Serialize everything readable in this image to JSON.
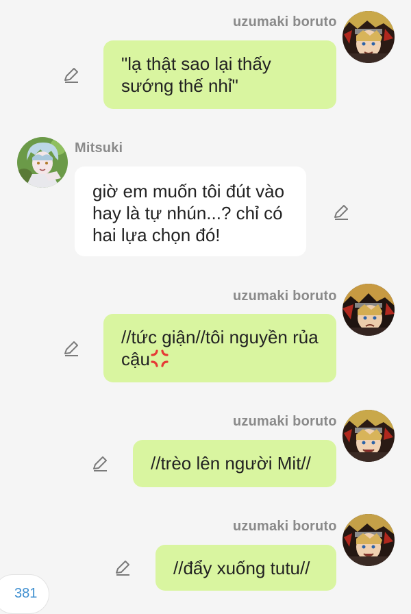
{
  "messages": [
    {
      "sender": "uzumaki boruto",
      "side": "right",
      "text": "\"lạ thật sao lại thấy sướng thế nhỉ\""
    },
    {
      "sender": "Mitsuki",
      "side": "left",
      "text": "giờ em muốn tôi đút vào hay là tự nhún...? chỉ có hai lựa chọn đó!"
    },
    {
      "sender": "uzumaki boruto",
      "side": "right",
      "text": "//tức giận//tôi nguyền rủa cậu",
      "emoji": "anger-symbol"
    },
    {
      "sender": "uzumaki boruto",
      "side": "right",
      "text": "//trèo lên người Mit//"
    },
    {
      "sender": "uzumaki boruto",
      "side": "right",
      "text": "//đẩy xuống tutu//"
    }
  ],
  "icons": {
    "edit": "pencil-icon",
    "boruto_avatar": "avatar-boruto",
    "mitsuki_avatar": "avatar-mitsuki"
  },
  "colors": {
    "my_bubble": "#d9f5a0",
    "their_bubble": "#ffffff",
    "background": "#f5f5f5",
    "badge_text": "#3f8fd0",
    "anger_emoji": "#e53935"
  },
  "counter": {
    "value": "381"
  }
}
